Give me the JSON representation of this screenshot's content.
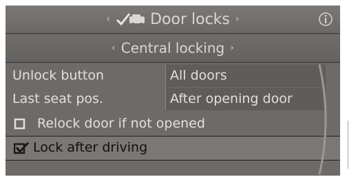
{
  "header": {
    "title": "Door locks",
    "left_arrow": "‹",
    "right_arrow": "›",
    "icon": "car-lock-icon",
    "info_icon": "info-icon"
  },
  "submenu": {
    "title": "Central locking",
    "left_arrow": "‹",
    "right_arrow": "›"
  },
  "settings": [
    {
      "label": "Unlock button",
      "value": "All doors"
    },
    {
      "label": "Last seat pos.",
      "value": "After opening door"
    }
  ],
  "options": [
    {
      "label": "Relock door if not opened",
      "checked": false,
      "selected": false
    },
    {
      "label": "Lock after driving",
      "checked": true,
      "selected": true
    }
  ],
  "colors": {
    "background": "#6d6a68",
    "text": "#e2e0dd",
    "selected_row": "#7a7775"
  }
}
